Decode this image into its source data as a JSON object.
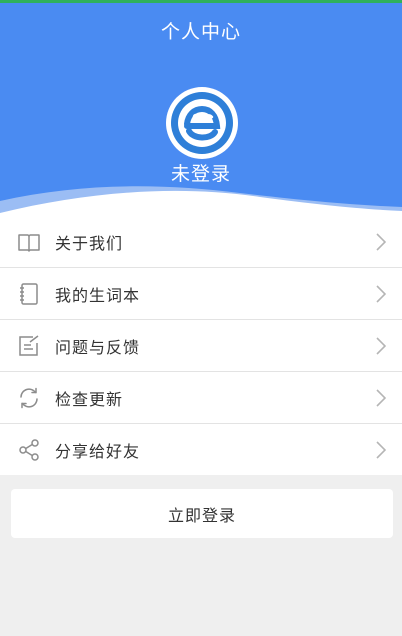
{
  "header": {
    "title": "个人中心",
    "login_status": "未登录",
    "background_color": "#4a8bf2"
  },
  "avatar": {
    "icon": "app-logo-e-wink",
    "accent_color": "#2e7fd8"
  },
  "menu": {
    "items": [
      {
        "label": "关于我们",
        "icon": "book-icon"
      },
      {
        "label": "我的生词本",
        "icon": "notebook-icon"
      },
      {
        "label": "问题与反馈",
        "icon": "edit-feedback-icon"
      },
      {
        "label": "检查更新",
        "icon": "refresh-icon"
      },
      {
        "label": "分享给好友",
        "icon": "share-icon"
      }
    ]
  },
  "login_button": {
    "label": "立即登录"
  }
}
